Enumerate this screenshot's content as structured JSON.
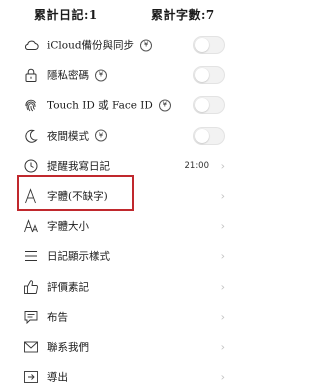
{
  "stats": {
    "diary_count": "累計日記:1",
    "word_count": "累計字數:7"
  },
  "colors": {
    "highlight": "#c0282d",
    "toggle_off": "#f2f2f2",
    "chevron": "#c4c4c4"
  },
  "settings": [
    {
      "label": "iCloud備份與同步",
      "icon": "cloud-icon",
      "vip": "¥",
      "control": "toggle",
      "on": false
    },
    {
      "label": "隱私密碼",
      "icon": "lock-icon",
      "vip": "¥",
      "control": "toggle",
      "on": false
    },
    {
      "label": "Touch ID 或 Face ID",
      "icon": "fingerprint-icon",
      "vip": "¥",
      "control": "toggle",
      "on": false
    },
    {
      "label": "夜間模式",
      "icon": "moon-icon",
      "vip": "¥",
      "control": "toggle",
      "on": false
    },
    {
      "label": "提醒我寫日記",
      "icon": "clock-icon",
      "value": "21:00",
      "control": "chevron",
      "chevron": "›"
    },
    {
      "label": "字體(不缺字)",
      "icon": "font-icon",
      "control": "chevron",
      "chevron": "›",
      "highlighted": true
    },
    {
      "label": "字體大小",
      "icon": "font-size-icon",
      "control": "chevron",
      "chevron": "›"
    },
    {
      "label": "日記顯示樣式",
      "icon": "list-icon",
      "control": "chevron",
      "chevron": "›"
    },
    {
      "label": "評價素記",
      "icon": "thumbs-up-icon",
      "control": "chevron",
      "chevron": "›"
    },
    {
      "label": "布告",
      "icon": "announcement-icon",
      "control": "chevron",
      "chevron": "›"
    },
    {
      "label": "聯系我們",
      "icon": "mail-icon",
      "control": "chevron",
      "chevron": "›"
    },
    {
      "label": "導出",
      "icon": "export-icon",
      "control": "chevron",
      "chevron": "›"
    }
  ]
}
